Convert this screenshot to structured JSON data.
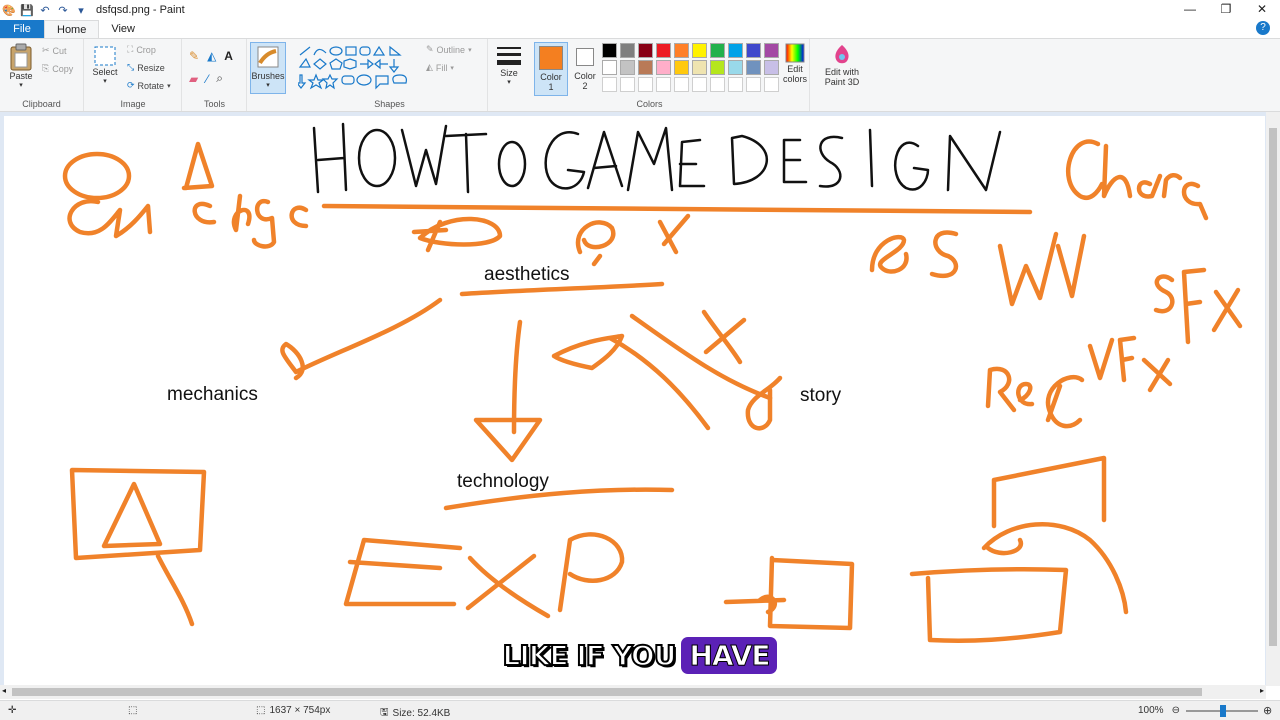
{
  "window": {
    "title": "dsfqsd.png - Paint",
    "controls": [
      "—",
      "❐",
      "✕"
    ]
  },
  "tabs": {
    "file": "File",
    "home": "Home",
    "view": "View"
  },
  "ribbon": {
    "clipboard": {
      "label": "Clipboard",
      "paste": "Paste",
      "cut": "Cut",
      "copy": "Copy"
    },
    "image": {
      "label": "Image",
      "select": "Select",
      "crop": "Crop",
      "resize": "Resize",
      "rotate": "Rotate"
    },
    "tools": {
      "label": "Tools"
    },
    "brushes": {
      "label": "Brushes"
    },
    "shapes": {
      "label": "Shapes",
      "outline": "Outline",
      "fill": "Fill"
    },
    "size": {
      "label": "Size"
    },
    "colors": {
      "label": "Colors",
      "color1_line1": "Color",
      "color1_line2": "1",
      "color2_line1": "Color",
      "color2_line2": "2",
      "edit_line1": "Edit",
      "edit_line2": "colors",
      "paint3d_line1": "Edit with",
      "paint3d_line2": "Paint 3D",
      "color1_value": "#f47f20",
      "color2_value": "#ffffff",
      "palette": [
        "#000000",
        "#7f7f7f",
        "#880015",
        "#ed1c24",
        "#ff7f27",
        "#fff200",
        "#22b14c",
        "#00a2e8",
        "#3f48cc",
        "#a349a4",
        "#ffffff",
        "#c3c3c3",
        "#b97a57",
        "#ffaec9",
        "#ffc90e",
        "#efe4b0",
        "#b5e61d",
        "#99d9ea",
        "#7092be",
        "#c8bfe7"
      ]
    }
  },
  "canvas": {
    "words": {
      "aesthetics": "aesthetics",
      "mechanics": "mechanics",
      "story": "story",
      "technology": "technology"
    },
    "ink_color": "#f0822a"
  },
  "caption": {
    "plain": "LIKE IF YOU",
    "highlight": "HAVE"
  },
  "status": {
    "dimensions": "1637 × 754px",
    "size": "Size: 52.4KB",
    "zoom": "100%"
  }
}
